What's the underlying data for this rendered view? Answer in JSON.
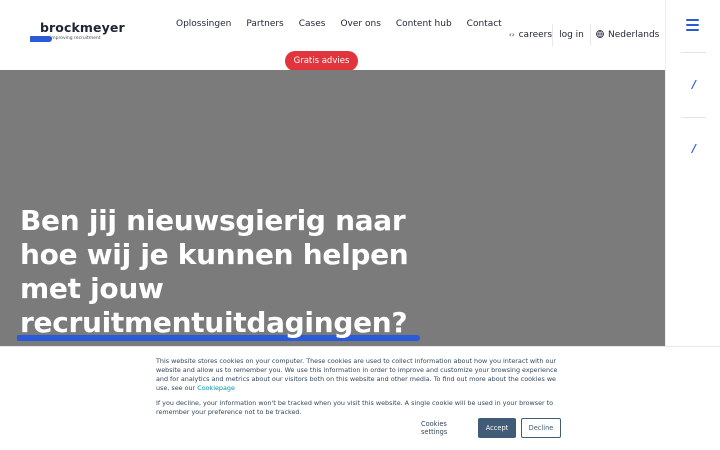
{
  "logo": {
    "name": "brockmeyer",
    "tagline": "improving recruitment"
  },
  "nav": {
    "items": [
      {
        "label": "Oplossingen"
      },
      {
        "label": "Partners"
      },
      {
        "label": "Cases"
      },
      {
        "label": "Over ons"
      },
      {
        "label": "Content hub"
      },
      {
        "label": "Contact"
      }
    ],
    "cta_label": "Gratis advies"
  },
  "utility": {
    "careers_label": "careers",
    "careers_icon": "careers-icon",
    "login_label": "log in",
    "language_label": "Nederlands",
    "language_icon": "globe-icon"
  },
  "rail": {
    "menu_icon": "hamburger-menu-icon",
    "buttons": [
      {
        "icon": "phone-icon"
      },
      {
        "icon": "phone-icon"
      }
    ]
  },
  "hero": {
    "title_lines": [
      "Ben jij nieuwsgierig naar",
      "hoe wij je kunnen helpen",
      "met jouw"
    ],
    "title_highlight": "recruitmentuitdagingen?"
  },
  "cookie_banner": {
    "paragraph_1": "This website stores cookies on your computer. These cookies are used to collect information about how you interact with our website and allow us to remember you. We use this information in order to improve and customize your browsing experience and for analytics and metrics about our visitors both on this website and other media. To find out more about the cookies we use, see our",
    "paragraph_1_link": "Cookiepage",
    "paragraph_2": "If you decline, your information won't be tracked when you visit this website. A single cookie will be used in your browser to remember your preference not to be tracked.",
    "settings_label": "Cookies settings",
    "accept_label": "Accept",
    "decline_label": "Decline"
  },
  "colors": {
    "brand_blue": "#2b5ad6",
    "cta_red": "#e0353d",
    "hero_bg": "#7b7b7b",
    "cookie_button": "#425b76"
  }
}
